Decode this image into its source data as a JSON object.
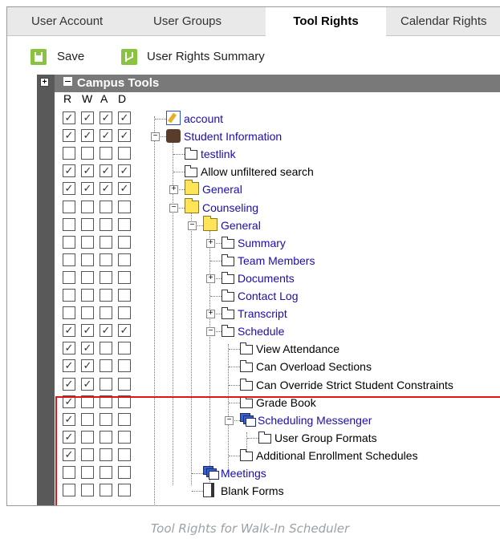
{
  "tabs": [
    "User Account",
    "User Groups",
    "Tool Rights",
    "Calendar Rights"
  ],
  "active_tab": "Tool Rights",
  "toolbar": {
    "save_label": "Save",
    "summary_label": "User Rights Summary"
  },
  "tree": {
    "header_label": "Campus Tools",
    "columns": [
      "R",
      "W",
      "A",
      "D"
    ],
    "rows": [
      {
        "label": "account",
        "link": true,
        "icon": "edit-icon",
        "rights": [
          true,
          true,
          true,
          true
        ]
      },
      {
        "label": "Student Information",
        "link": true,
        "icon": "person-icon",
        "rights": [
          true,
          true,
          true,
          true
        ]
      },
      {
        "label": "testlink",
        "link": true,
        "icon": "page-icon",
        "rights": [
          false,
          false,
          false,
          false
        ]
      },
      {
        "label": "Allow unfiltered search",
        "link": false,
        "icon": "page-icon",
        "rights": [
          true,
          true,
          true,
          true
        ]
      },
      {
        "label": "General",
        "link": true,
        "icon": "folder-icon",
        "rights": [
          true,
          true,
          true,
          true
        ]
      },
      {
        "label": "Counseling",
        "link": true,
        "icon": "folder-icon",
        "rights": [
          false,
          false,
          false,
          false
        ]
      },
      {
        "label": "General",
        "link": true,
        "icon": "folder-icon",
        "rights": [
          false,
          false,
          false,
          false
        ]
      },
      {
        "label": "Summary",
        "link": true,
        "icon": "page-icon",
        "rights": [
          false,
          false,
          false,
          false
        ]
      },
      {
        "label": "Team Members",
        "link": true,
        "icon": "page-icon",
        "rights": [
          false,
          false,
          false,
          false
        ]
      },
      {
        "label": "Documents",
        "link": true,
        "icon": "page-icon",
        "rights": [
          false,
          false,
          false,
          false
        ]
      },
      {
        "label": "Contact Log",
        "link": true,
        "icon": "page-icon",
        "rights": [
          false,
          false,
          false,
          false
        ]
      },
      {
        "label": "Transcript",
        "link": true,
        "icon": "page-icon",
        "rights": [
          false,
          false,
          false,
          false
        ]
      },
      {
        "label": "Schedule",
        "link": true,
        "icon": "page-icon",
        "rights": [
          true,
          true,
          true,
          true
        ]
      },
      {
        "label": "View Attendance",
        "link": false,
        "icon": "page-icon",
        "rights": [
          true,
          true,
          false,
          false
        ]
      },
      {
        "label": "Can Overload Sections",
        "link": false,
        "icon": "page-icon",
        "rights": [
          true,
          true,
          false,
          false
        ]
      },
      {
        "label": "Can Override Strict Student Constraints",
        "link": false,
        "icon": "page-icon",
        "rights": [
          true,
          true,
          false,
          false
        ]
      },
      {
        "label": "Grade Book",
        "link": false,
        "icon": "page-icon",
        "rights": [
          true,
          false,
          false,
          false
        ]
      },
      {
        "label": "Scheduling Messenger",
        "link": true,
        "icon": "multi-icon",
        "rights": [
          true,
          false,
          false,
          false
        ]
      },
      {
        "label": "User Group Formats",
        "link": false,
        "icon": "page-icon",
        "rights": [
          true,
          false,
          false,
          false
        ]
      },
      {
        "label": "Additional Enrollment Schedules",
        "link": false,
        "icon": "page-icon",
        "rights": [
          true,
          false,
          false,
          false
        ]
      },
      {
        "label": "Meetings",
        "link": true,
        "icon": "multi-icon",
        "rights": [
          false,
          false,
          false,
          false
        ]
      },
      {
        "label": "Blank Forms",
        "link": false,
        "icon": "doc-icon",
        "rights": [
          false,
          false,
          false,
          false
        ]
      }
    ]
  },
  "caption": "Tool Rights for Walk-In Scheduler",
  "colors": {
    "accent_green": "#8ac33f",
    "link_blue": "#1a0dab",
    "highlight_red": "#e01414",
    "header_gray": "#797979"
  }
}
